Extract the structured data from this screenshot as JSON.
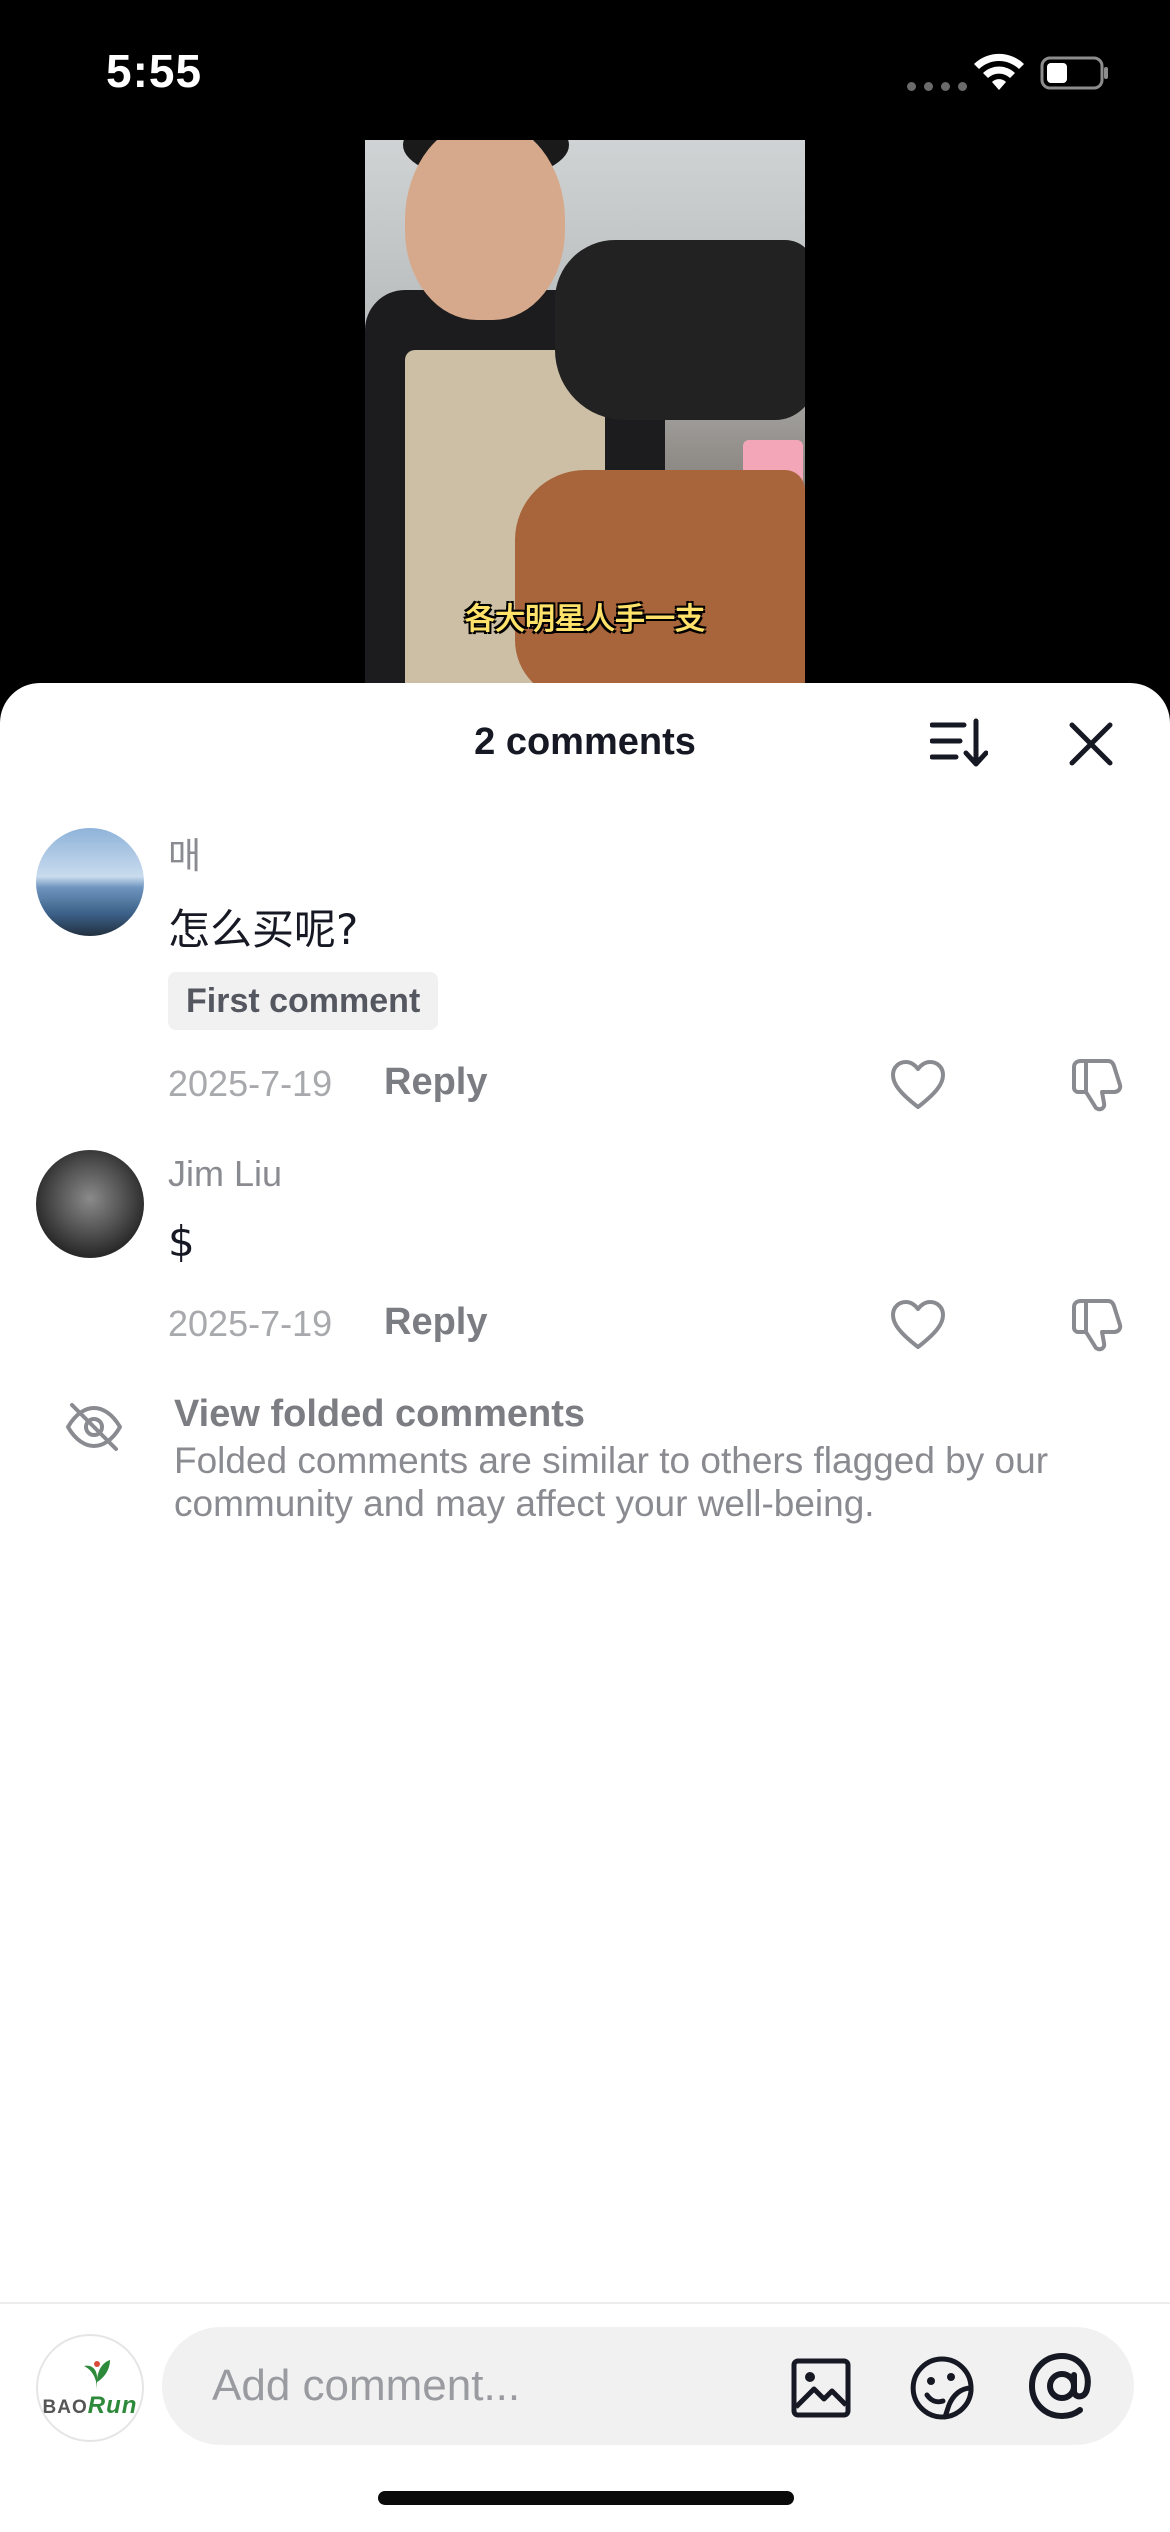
{
  "status_bar": {
    "time": "5:55"
  },
  "video": {
    "caption": "各大明星人手一支"
  },
  "sheet": {
    "title": "2 comments",
    "sort_icon": "sort-icon",
    "close_icon": "close-icon"
  },
  "comments": [
    {
      "username": "매",
      "text": "怎么买呢?",
      "badge": "First comment",
      "date": "2025-7-19",
      "reply_label": "Reply"
    },
    {
      "username": "Jim Liu",
      "text": "$",
      "date": "2025-7-19",
      "reply_label": "Reply"
    }
  ],
  "folded": {
    "title": "View folded comments",
    "description": "Folded comments are similar to others flagged by our community and may affect your well-being."
  },
  "composer": {
    "avatar_text_a": "BAO",
    "avatar_text_b": "Run",
    "placeholder": "Add comment..."
  },
  "colors": {
    "sheet_bg": "#ffffff",
    "muted_text": "#8a8b91",
    "primary_text": "#161823",
    "logo_green": "#2d8a3a"
  }
}
